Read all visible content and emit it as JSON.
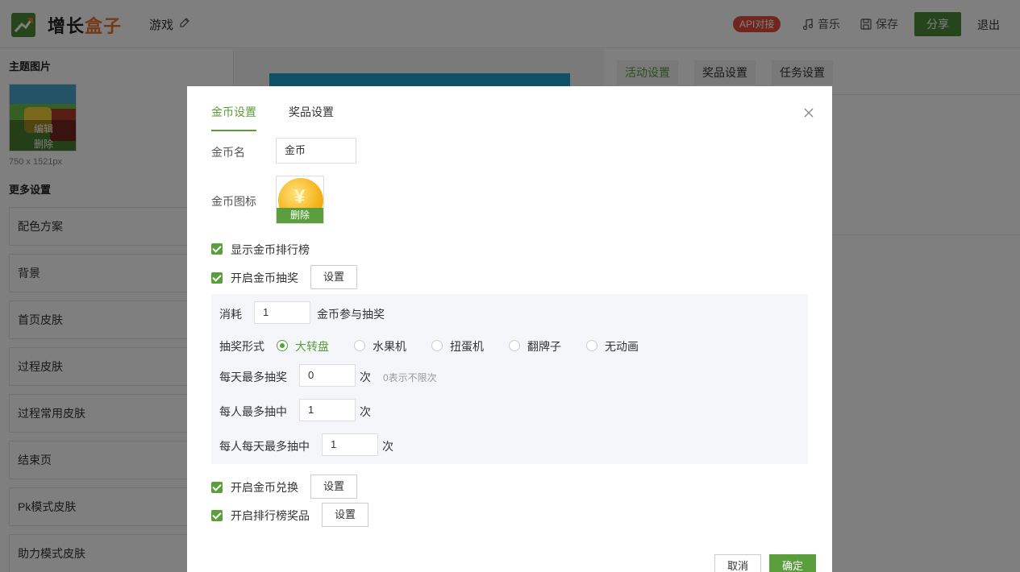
{
  "header": {
    "logo_text_a": "增长",
    "logo_text_b": "盒子",
    "game_name": "游戏",
    "api_badge": "API对接",
    "music": "音乐",
    "save": "保存",
    "share": "分享",
    "logout": "退出"
  },
  "sidebar": {
    "theme_title": "主题图片",
    "thumb_edit": "编辑",
    "thumb_delete": "删除",
    "thumb_size": "750 x 1521px",
    "more_title": "更多设置",
    "items": [
      "配色方案",
      "背景",
      "首页皮肤",
      "过程皮肤",
      "过程常用皮肤",
      "结束页",
      "Pk模式皮肤",
      "助力模式皮肤"
    ]
  },
  "right_panel": {
    "tabs": [
      "活动设置",
      "奖品设置",
      "任务设置"
    ]
  },
  "modal": {
    "tabs": [
      "金币设置",
      "奖品设置"
    ],
    "coin_name_label": "金币名",
    "coin_name_value": "金币",
    "coin_icon_label": "金币图标",
    "coin_icon_delete": "删除",
    "show_rank": "显示金币排行榜",
    "enable_lottery": "开启金币抽奖",
    "set_btn": "设置",
    "consume_label": "消耗",
    "consume_value": "1",
    "consume_suffix": "金币参与抽奖",
    "form_label": "抽奖形式",
    "forms": [
      "大转盘",
      "水果机",
      "扭蛋机",
      "翻牌子",
      "无动画"
    ],
    "daily_max_label": "每天最多抽奖",
    "daily_max_value": "0",
    "times": "次",
    "daily_hint": "0表示不限次",
    "per_user_label": "每人最多抽中",
    "per_user_value": "1",
    "per_user_daily_label": "每人每天最多抽中",
    "per_user_daily_value": "1",
    "enable_exchange": "开启金币兑换",
    "enable_rank_prize": "开启排行榜奖品",
    "cancel": "取消",
    "confirm": "确定"
  },
  "colors": {
    "accent_green": "#5a9e3d",
    "badge_red": "#e04a3f",
    "logo_orange": "#e8752f"
  }
}
